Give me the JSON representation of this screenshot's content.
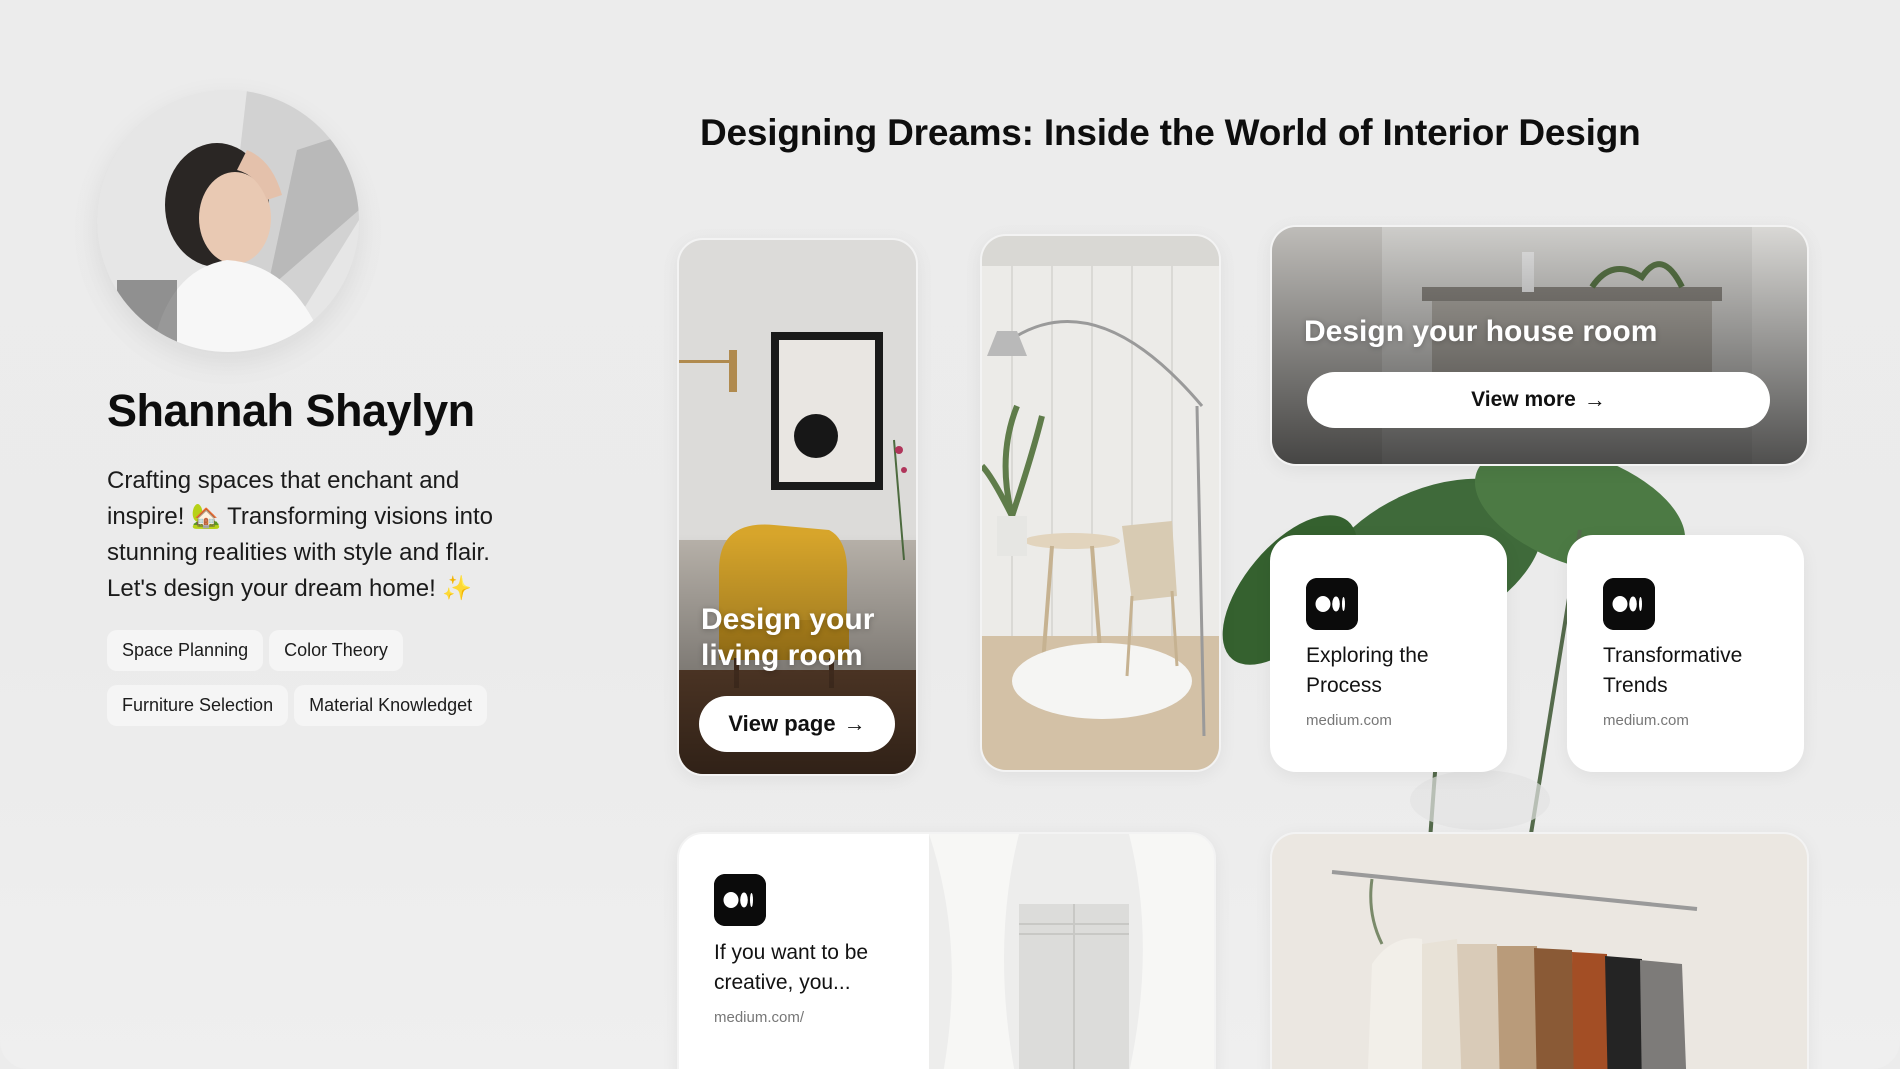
{
  "profile": {
    "name": "Shannah Shaylyn",
    "bio": "Crafting spaces that enchant and inspire! 🏡 Transforming visions into stunning realities with style and flair. Let's design your dream home! ✨",
    "tags": [
      "Space Planning",
      "Color Theory",
      "Furniture Selection",
      "Material Knowledget"
    ]
  },
  "headline": "Designing Dreams: Inside the World of Interior Design",
  "cards": {
    "living": {
      "title": "Design your living room",
      "button": "View page",
      "arrow": "→"
    },
    "house": {
      "title": "Design your house room",
      "button": "View more",
      "arrow": "→"
    },
    "explore": {
      "title": "Exploring the Process",
      "domain": "medium.com"
    },
    "trends": {
      "title": "Transformative Trends",
      "domain": "medium.com"
    },
    "creative": {
      "title": "If you want to be creative, you...",
      "domain": "medium.com/"
    }
  },
  "colors": {
    "background": "#ececec",
    "card": "#ffffff",
    "icon_bg": "#0b0b0b",
    "accent_yellow": "#d4a020"
  }
}
